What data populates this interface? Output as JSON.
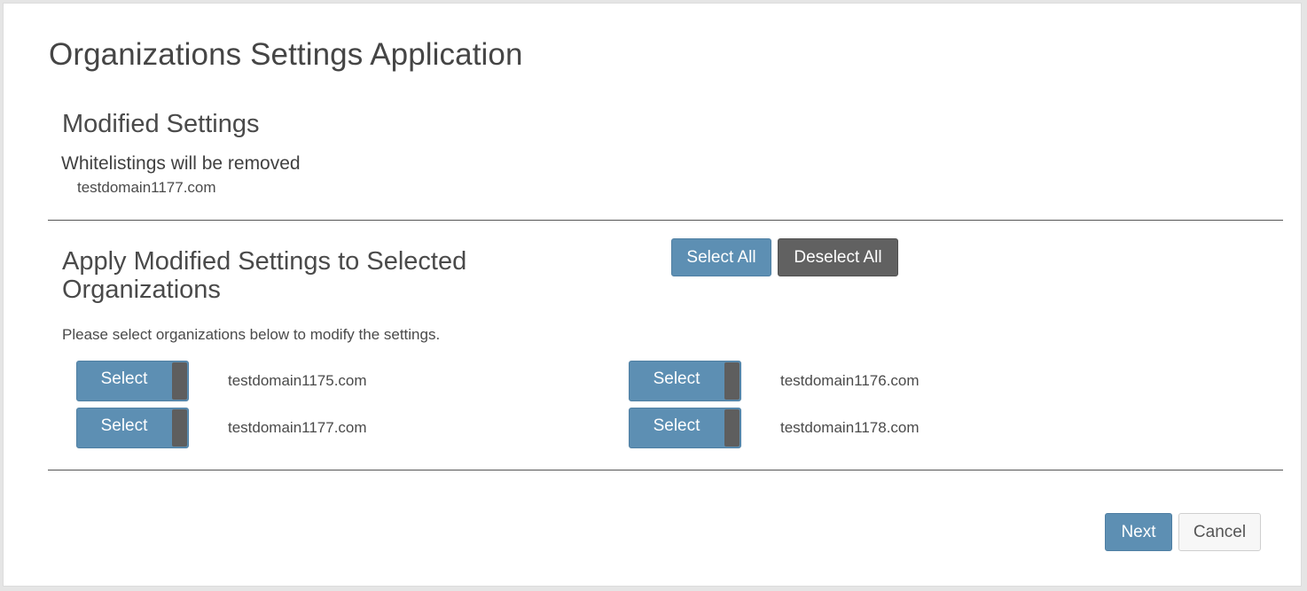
{
  "page": {
    "title": "Organizations Settings Application"
  },
  "modified": {
    "title": "Modified Settings",
    "subtitle": "Whitelistings will be removed",
    "items": [
      "testdomain1177.com"
    ]
  },
  "apply": {
    "title": "Apply Modified Settings to Selected Organizations",
    "select_all_label": "Select All",
    "deselect_all_label": "Deselect All",
    "instruction": "Please select organizations below to modify the settings."
  },
  "organizations": [
    {
      "toggle_label": "Select",
      "name": "testdomain1175.com"
    },
    {
      "toggle_label": "Select",
      "name": "testdomain1176.com"
    },
    {
      "toggle_label": "Select",
      "name": "testdomain1177.com"
    },
    {
      "toggle_label": "Select",
      "name": "testdomain1178.com"
    }
  ],
  "footer": {
    "next_label": "Next",
    "cancel_label": "Cancel"
  },
  "colors": {
    "primary": "#5d8fb3",
    "secondary": "#616161",
    "background": "#ffffff"
  }
}
